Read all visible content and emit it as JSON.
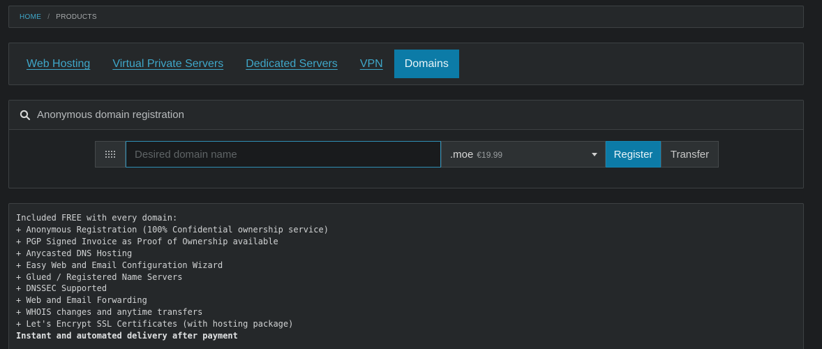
{
  "breadcrumb": {
    "home": "HOME",
    "separator": "/",
    "current": "PRODUCTS"
  },
  "nav": {
    "tabs": [
      {
        "label": "Web Hosting",
        "active": false
      },
      {
        "label": "Virtual Private Servers",
        "active": false
      },
      {
        "label": "Dedicated Servers",
        "active": false
      },
      {
        "label": "VPN",
        "active": false
      },
      {
        "label": "Domains",
        "active": true
      }
    ]
  },
  "registration": {
    "title": "Anonymous domain registration",
    "icon": "search-icon",
    "addon_icon": "dots-grid-icon",
    "input_value": "",
    "input_placeholder": "Desired domain name",
    "tld": ".moe",
    "tld_price": "€19.99",
    "register_label": "Register",
    "transfer_label": "Transfer"
  },
  "features": {
    "heading": "Included FREE with every domain:",
    "items": [
      "+ Anonymous Registration (100% Confidential ownership service)",
      "+ PGP Signed Invoice as Proof of Ownership available",
      "+ Anycasted DNS Hosting",
      "+ Easy Web and Email Configuration Wizard",
      "+ Glued / Registered Name Servers",
      "+ DNSSEC Supported",
      "+ Web and Email Forwarding",
      "+ WHOIS changes and anytime transfers",
      "+ Let's Encrypt SSL Certificates (with hosting package)"
    ],
    "footer": "Instant and automated delivery after payment"
  },
  "colors": {
    "accent": "#0c7ba7",
    "link": "#3fa7c9",
    "background": "#1c1e20",
    "panel": "#25282a"
  }
}
